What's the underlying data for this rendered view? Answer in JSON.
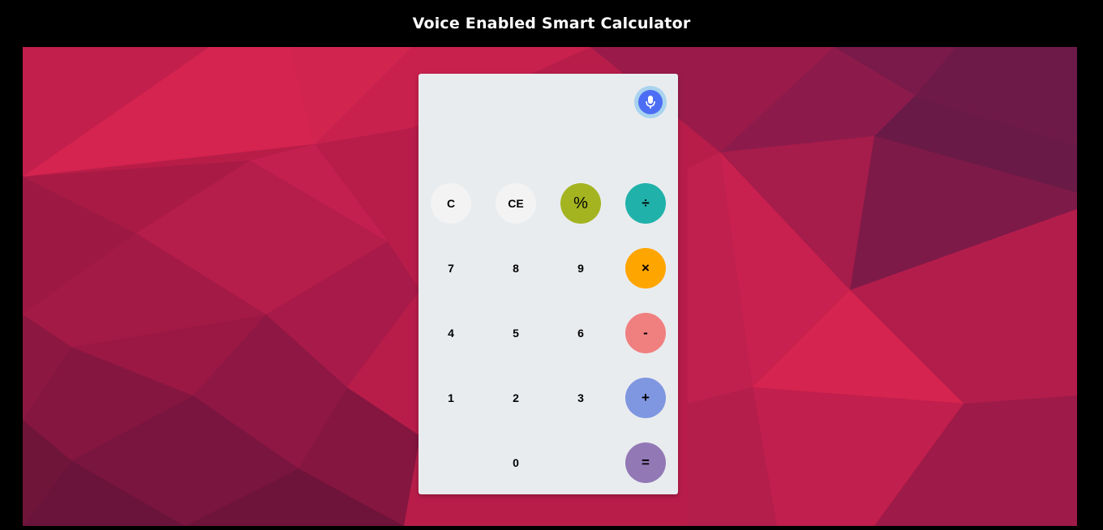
{
  "header": {
    "title": "Voice Enabled Smart Calculator"
  },
  "calculator": {
    "display": "",
    "mic": {
      "icon": "microphone-icon"
    },
    "rows": [
      [
        {
          "label": "C",
          "name": "clear-button",
          "style": "light",
          "color": ""
        },
        {
          "label": "CE",
          "name": "clear-entry-button",
          "style": "light",
          "color": ""
        },
        {
          "label": "%",
          "name": "percent-button",
          "style": "op",
          "color": "#a4b421"
        },
        {
          "label": "÷",
          "name": "divide-button",
          "style": "op",
          "color": "#20b2aa"
        }
      ],
      [
        {
          "label": "7",
          "name": "digit-7-button",
          "style": "plain",
          "color": ""
        },
        {
          "label": "8",
          "name": "digit-8-button",
          "style": "plain",
          "color": ""
        },
        {
          "label": "9",
          "name": "digit-9-button",
          "style": "plain",
          "color": ""
        },
        {
          "label": "×",
          "name": "multiply-button",
          "style": "op",
          "color": "#ffa500"
        }
      ],
      [
        {
          "label": "4",
          "name": "digit-4-button",
          "style": "plain",
          "color": ""
        },
        {
          "label": "5",
          "name": "digit-5-button",
          "style": "plain",
          "color": ""
        },
        {
          "label": "6",
          "name": "digit-6-button",
          "style": "plain",
          "color": ""
        },
        {
          "label": "-",
          "name": "subtract-button",
          "style": "op",
          "color": "#f08080"
        }
      ],
      [
        {
          "label": "1",
          "name": "digit-1-button",
          "style": "plain",
          "color": ""
        },
        {
          "label": "2",
          "name": "digit-2-button",
          "style": "plain",
          "color": ""
        },
        {
          "label": "3",
          "name": "digit-3-button",
          "style": "plain",
          "color": ""
        },
        {
          "label": "+",
          "name": "add-button",
          "style": "op",
          "color": "#7f96e0"
        }
      ],
      [
        null,
        {
          "label": "0",
          "name": "digit-0-button",
          "style": "plain",
          "color": ""
        },
        null,
        {
          "label": "=",
          "name": "equals-button",
          "style": "op",
          "color": "#9278b5"
        }
      ]
    ]
  },
  "colors": {
    "page_background": "#000000",
    "panel": "#e9ecef",
    "mic_ring": "#a9d3ee",
    "mic_fill": "#4c6ef5",
    "backdrop": "#b81d4a"
  }
}
